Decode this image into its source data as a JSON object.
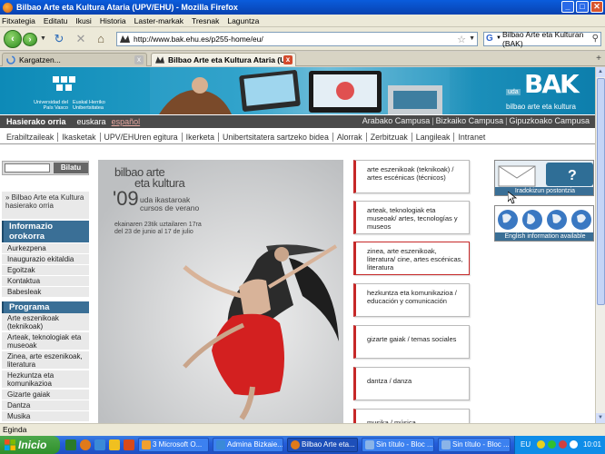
{
  "window": {
    "title": "Bilbao Arte eta Kultura Ataria (UPV/EHU) - Mozilla Firefox",
    "min": "_",
    "max": "□",
    "close": "✕"
  },
  "menubar": [
    "Fitxategia",
    "Editatu",
    "Ikusi",
    "Historia",
    "Laster-markak",
    "Tresnak",
    "Laguntza"
  ],
  "navbar": {
    "url": "http://www.bak.ehu.es/p255-home/eu/",
    "search_text": "Bilbao Arte eta Kulturan (BAK)"
  },
  "tabs": [
    {
      "label": "Kargatzen...",
      "close": "x"
    },
    {
      "label": "Bilbao Arte eta Kultura Ataria (U...",
      "close": "x"
    }
  ],
  "tab_add": "+",
  "banner": {
    "ehu_left": "Universidad del País Vasco",
    "ehu_right": "Euskal Herriko Unibertsitatea",
    "bak_uda": "uda",
    "bak_big": "BAK",
    "bak_sub": "bilbao arte eta kultura"
  },
  "topnav": {
    "home": "Hasierako orria",
    "lang_eu": "euskara",
    "lang_es": "español",
    "campus": [
      "Arabako Campusa",
      "Bizkaiko Campusa",
      "Gipuzkoako Campusa"
    ],
    "campus_sep": "|"
  },
  "menu2": [
    "Erabiltzaileak",
    "Ikasketak",
    "UPV/EHUren egitura",
    "Ikerketa",
    "Unibertsitatera sartzeko bidea",
    "Alorrak",
    "Zerbitzuak",
    "Langileak",
    "Intranet"
  ],
  "sidebar": {
    "search_button": "Bilatu",
    "link": "» Bilbao Arte eta Kultura hasierako orria",
    "sections": [
      {
        "title": "Informazio orokorra",
        "items": [
          "Aurkezpena",
          "Inaugurazio ekitaldia",
          "Egoitzak",
          "Kontaktua",
          "Babesleak"
        ]
      },
      {
        "title": "Programa",
        "items": [
          "Arte eszenikoak (teknikoak)",
          "Arteak, teknologiak eta museoak",
          "Zinea, arte eszenikoak, literatura",
          "Hezkuntza eta komunikazioa",
          "Gizarte gaiak",
          "Dantza",
          "Musika"
        ]
      }
    ]
  },
  "poster": {
    "line1": "bilbao arte",
    "line2": "eta kultura",
    "num": "'09",
    "line3a": "uda ikastaroak",
    "line3b": "cursos de verano",
    "dates_eu": "ekainaren 23tik uztailaren 17ra",
    "dates_es": "del 23 de junio al 17 de julio"
  },
  "categories": [
    "arte eszenikoak (teknikoak) / artes escénicas (técnicos)",
    "arteak, teknologiak eta museoak/ artes, tecnologías y museos",
    "zinea, arte eszenikoak, literatura/ cine, artes escénicas, literatura",
    "hezkuntza eta komunikazioa / educación y comunicación",
    "gizarte gaiak / temas sociales",
    "dantza / danza",
    "musika / música"
  ],
  "right_boxes": [
    "Iradokizun postontzia",
    "English information available"
  ],
  "status": "Egindа",
  "taskbar": {
    "start": "Inicio",
    "tasks": [
      "3 Microsoft O...",
      "Admina Bizkaie...",
      "Bilbao Arte eta...",
      "Sin título - Bloc ...",
      "Sin título - Bloc ...",
      "Sin título - Bloc ..."
    ],
    "lang": "EU",
    "clock": "10:01"
  },
  "colors": {
    "accent_red": "#c62828",
    "sidebar_blue": "#3a6f96",
    "banner_teal": "#1b8fba"
  }
}
